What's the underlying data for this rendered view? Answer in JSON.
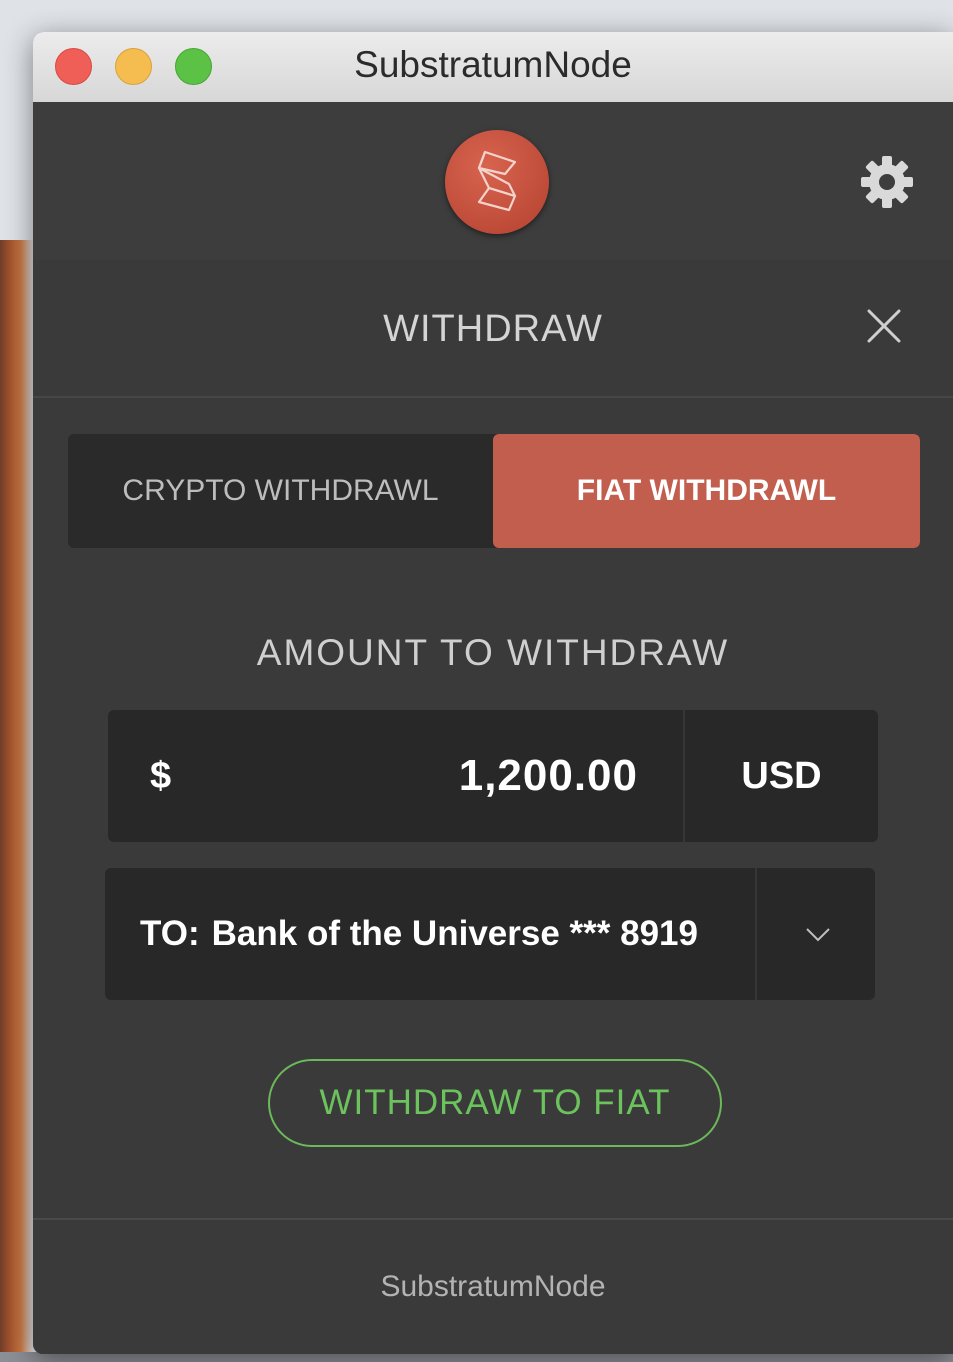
{
  "window": {
    "title": "SubstratumNode"
  },
  "panel": {
    "title": "WITHDRAW"
  },
  "tabs": [
    {
      "label": "CRYPTO WITHDRAWL",
      "active": false
    },
    {
      "label": "FIAT WITHDRAWL",
      "active": true
    }
  ],
  "amount": {
    "label": "AMOUNT TO WITHDRAW",
    "currency_sign": "$",
    "value": "1,200.00",
    "currency_code": "USD"
  },
  "destination": {
    "prefix": "TO:",
    "account": "Bank of the Universe *** 8919"
  },
  "submit": {
    "label": "WITHDRAW TO FIAT"
  },
  "footer": {
    "text": "SubstratumNode"
  },
  "colors": {
    "accent": "#c25e4e",
    "success": "#6cc25c",
    "panel_bg": "#3a3a3a",
    "field_bg": "#282828"
  },
  "icons": [
    "substratum-logo-icon",
    "gear-icon",
    "close-icon",
    "chevron-down-icon"
  ]
}
